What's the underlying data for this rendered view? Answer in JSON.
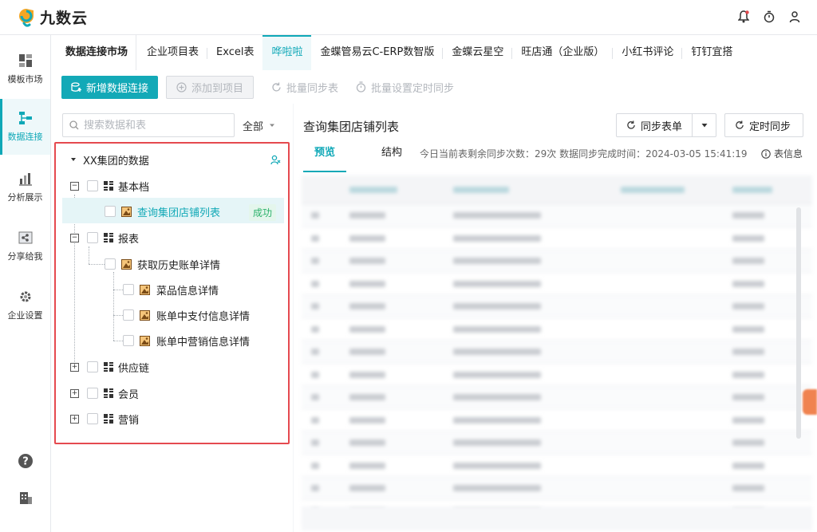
{
  "app": {
    "name": "九数云"
  },
  "nav": {
    "items": [
      {
        "label": "模板市场",
        "icon": "template-grid-icon",
        "active": false
      },
      {
        "label": "数据连接",
        "icon": "data-connection-icon",
        "active": true
      },
      {
        "label": "分析展示",
        "icon": "analysis-chart-icon",
        "active": false
      },
      {
        "label": "分享给我",
        "icon": "share-icon",
        "active": false
      },
      {
        "label": "企业设置",
        "icon": "settings-gear-icon",
        "active": false
      }
    ]
  },
  "tabs": {
    "title": "数据连接市场",
    "items": [
      "企业项目表",
      "Excel表",
      "哗啦啦",
      "金蝶管易云C-ERP数智版",
      "金蝶云星空",
      "旺店通（企业版）",
      "小红书评论",
      "钉钉宜搭"
    ],
    "active_index": 2
  },
  "toolbar": {
    "new_connection": "新增数据连接",
    "add_to_project": "添加到项目",
    "batch_sync": "批量同步表",
    "batch_schedule": "批量设置定时同步"
  },
  "left": {
    "search_placeholder": "搜索数据和表",
    "filter_value": "全部",
    "tree": {
      "root": "XX集团的数据",
      "nodes": [
        {
          "label": "基本档",
          "expanded": true
        },
        {
          "label": "查询集团店铺列表",
          "status": "成功",
          "selected": true
        },
        {
          "label": "报表",
          "expanded": true
        },
        {
          "label": "获取历史账单详情"
        },
        {
          "label": "菜品信息详情"
        },
        {
          "label": "账单中支付信息详情"
        },
        {
          "label": "账单中营销信息详情"
        },
        {
          "label": "供应链",
          "expanded": false
        },
        {
          "label": "会员",
          "expanded": false
        },
        {
          "label": "营销",
          "expanded": false
        }
      ]
    }
  },
  "right": {
    "title": "查询集团店铺列表",
    "sync_button": "同步表单",
    "schedule_button": "定时同步",
    "tabs": [
      "预览",
      "结构"
    ],
    "active_tab": 0,
    "info": "今日当前表剩余同步次数：29次   数据同步完成时间：2024-03-05 15:41:19",
    "table_info": "表信息"
  },
  "colors": {
    "accent": "#13a9b7",
    "highlight_border": "#e54a4f",
    "success": "#2cb26b"
  }
}
